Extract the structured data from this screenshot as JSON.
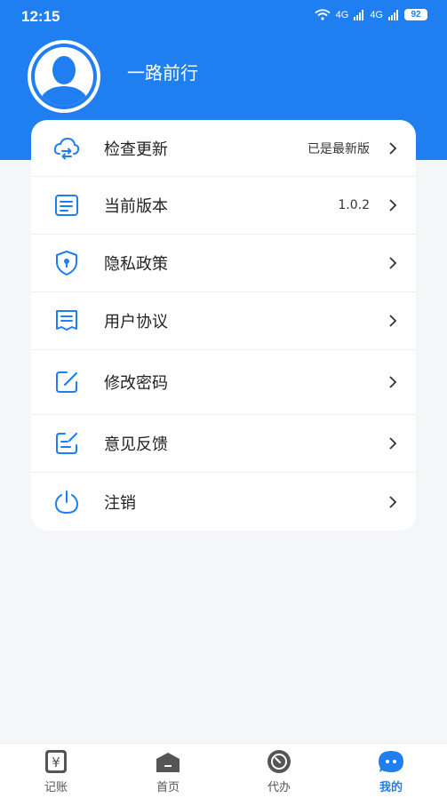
{
  "status_bar": {
    "time": "12:15",
    "signal1": "4G",
    "signal2": "4G",
    "battery": "92"
  },
  "profile": {
    "username": "一路前行"
  },
  "menu": [
    {
      "label": "检查更新",
      "value": "已是最新版"
    },
    {
      "label": "当前版本",
      "value": "1.0.2"
    },
    {
      "label": "隐私政策",
      "value": ""
    },
    {
      "label": "用户协议",
      "value": ""
    },
    {
      "label": "修改密码",
      "value": ""
    },
    {
      "label": "意见反馈",
      "value": ""
    },
    {
      "label": "注销",
      "value": ""
    }
  ],
  "tabbar": [
    {
      "label": "记账",
      "icon": "ledger-icon"
    },
    {
      "label": "首页",
      "icon": "home-icon"
    },
    {
      "label": "代办",
      "icon": "todo-icon"
    },
    {
      "label": "我的",
      "icon": "profile-icon"
    }
  ],
  "colors": {
    "accent": "#1f7ff1",
    "background": "#f5f6f8"
  }
}
